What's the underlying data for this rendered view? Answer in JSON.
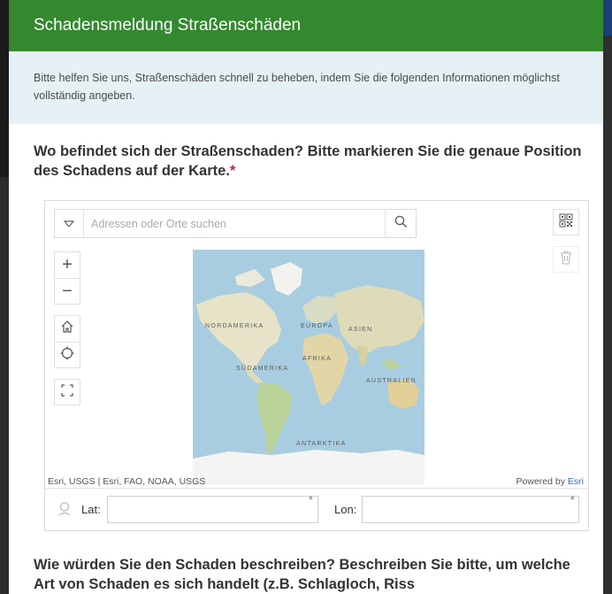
{
  "form": {
    "title": "Schadensmeldung Straßenschäden",
    "description": "Bitte helfen Sie uns, Straßenschäden schnell zu beheben, indem Sie die folgenden Informationen möglichst vollständig angeben.",
    "question1": {
      "text": "Wo befindet sich der Straßenschaden? Bitte markieren Sie die genaue Position des Schadens auf der Karte.",
      "required_marker": "*"
    },
    "question2": {
      "text": "Wie würden Sie den Schaden beschreiben? Beschreiben Sie bitte, um welche Art von Schaden es sich handelt (z.B. Schlagloch, Riss"
    }
  },
  "map": {
    "search": {
      "placeholder": "Adressen oder Orte suchen",
      "value": ""
    },
    "controls": [
      "zoom-in",
      "zoom-out",
      "home",
      "locate",
      "fullscreen",
      "qr-code",
      "delete"
    ],
    "zoom_in_label": "+",
    "zoom_out_label": "−",
    "labels": {
      "north_america": "NORDAMERIKA",
      "europe": "EUROPA",
      "asia": "ASIEN",
      "africa": "AFRIKA",
      "south_america": "SÜDAMERIKA",
      "australia": "AUSTRALIEN",
      "antarctica": "ANTARKTIKA"
    },
    "attribution": "Esri, USGS | Esri, FAO, NOAA, USGS",
    "powered_by": "Powered by",
    "powered_by_link": "Esri"
  },
  "coords": {
    "lat_label": "Lat:",
    "lat_value": "",
    "lon_label": "Lon:",
    "lon_value": "",
    "degree_symbol": "°"
  },
  "colors": {
    "header_bg": "#34882f",
    "description_bg": "#e6f1f5",
    "required": "#c8282f",
    "link": "#2d6cba",
    "ocean": "#a9cde0",
    "land": "#e6e3c8"
  }
}
